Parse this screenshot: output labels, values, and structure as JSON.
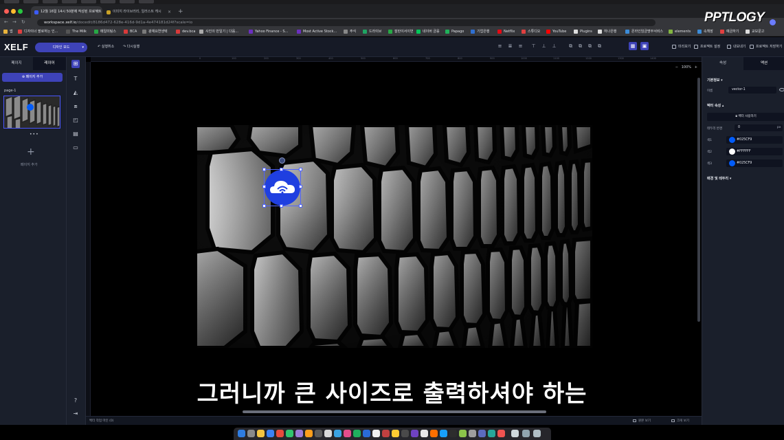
{
  "browser": {
    "tabs": [
      {
        "title": "12월 16일 14시 50분에 작성된 프로젝트",
        "active": true
      },
      {
        "title": "이미지 라이브러리, 일러스트 캐시",
        "active": false
      }
    ],
    "url_host": "workspace.xelf.io",
    "url_path": "/docedit/8186d472-628e-416d-9d1a-4e474181d24f?scale=io",
    "bookmarks": [
      "앱",
      "디자이너 팔로하는 인...",
      "The Milk",
      "메일미팅스",
      "BCA",
      "광재요연생텍",
      "dev.bca",
      "사진의 만일기 | 다음...",
      "Yahoo Finance - S...",
      "Most Active Stock...",
      "주식",
      "드라이브",
      "잘란이서이번",
      "네이버 금융",
      "Papago",
      "기업은행",
      "Netflix",
      "스튜디오",
      "YouTube",
      "Plugins",
      "하나은행",
      "온라인임금명부서비스",
      "elements",
      "속책장",
      "예금하기",
      "교보문고"
    ]
  },
  "app": {
    "logo": "XELF",
    "mode_label": "디자인 모드",
    "undo_label": "실행취소",
    "redo_label": "다시실행",
    "top_actions": [
      "미리보기",
      "프로젝트 설정",
      "내보내기",
      "프로젝트 저장하기"
    ]
  },
  "left_panel": {
    "tabs": [
      "페이지",
      "레이어"
    ],
    "add_page_button": "페이지 추가",
    "page_label": "page-1",
    "thumb_menu": "•••",
    "add_page_hint": "페이지 추가"
  },
  "canvas": {
    "ruler_ticks": [
      "0",
      "100",
      "200",
      "300",
      "400",
      "500",
      "600",
      "700",
      "800",
      "900",
      "1000",
      "1100",
      "1200",
      "1300",
      "1400"
    ],
    "zoom": "100%",
    "zoom_minus": "−",
    "zoom_plus": "+",
    "status_left": "벡터 작업 마인 (0)",
    "status_actions": [
      "원본 보기",
      "크게 보기"
    ]
  },
  "right_panel": {
    "tabs": [
      "속성",
      "액션"
    ],
    "basic_info_title": "기본정보 ▾",
    "name_label": "이름",
    "name_value": "vector-1",
    "vector_attr_title": "벡터 속성 ▴",
    "vector_button": "벡터 사용하기",
    "border_radius_label": "테두리 반경",
    "border_radius_value": "0",
    "border_radius_unit": "px",
    "colors": [
      {
        "label": "색1",
        "hex": "#025CF9"
      },
      {
        "label": "색2",
        "hex": "#FFFFFF"
      },
      {
        "label": "색3",
        "hex": "#025CF9"
      }
    ],
    "bg_border_title": "배경 및 테두리 ▾"
  },
  "overlay": {
    "subtitle": "그러니까 큰 사이즈로 출력하셔야 하는",
    "watermark": "PPTLOGY"
  },
  "icons": {
    "selected_vector": "cloud-wifi-icon"
  },
  "colors": {
    "accent": "#3E43B8",
    "selection": "#4F63FF",
    "vector_blue": "#025CF9"
  }
}
